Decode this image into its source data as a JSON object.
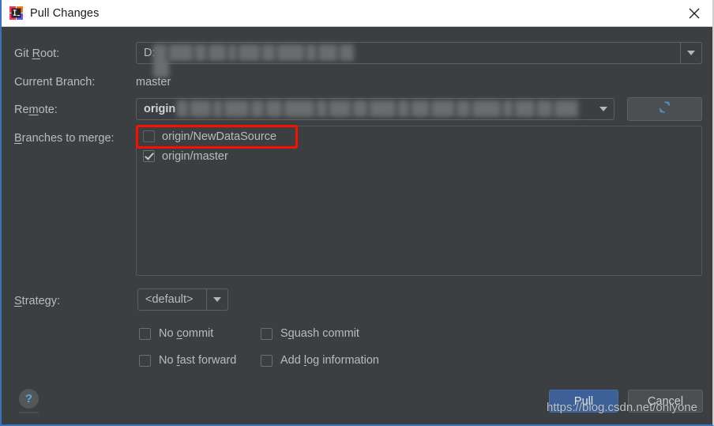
{
  "window": {
    "title": "Pull Changes",
    "app_icon": "intellij-idea-icon",
    "close_icon": "close-icon",
    "accent_color": "#3a74bf",
    "background_color": "#3c3f41",
    "text_color": "#bbbbbb"
  },
  "fields": {
    "git_root": {
      "label_before": "Git ",
      "label_mnemonic": "R",
      "label_after": "oot:",
      "value": "D:",
      "redacted": true,
      "dropdown_icon": "chevron-down-icon"
    },
    "current_branch": {
      "label": "Current Branch:",
      "value": "master"
    },
    "remote": {
      "label_before": "Re",
      "label_mnemonic": "m",
      "label_after": "ote:",
      "value": "origin",
      "redacted": true,
      "dropdown_icon": "chevron-down-icon",
      "refresh_icon": "refresh-icon",
      "refresh_color": "#4b8ec9"
    },
    "branches": {
      "label_before": "",
      "label_mnemonic": "B",
      "label_after": "ranches to merge:",
      "items": [
        {
          "name": "origin/NewDataSource",
          "checked": false,
          "highlighted": true
        },
        {
          "name": "origin/master",
          "checked": true,
          "highlighted": false
        }
      ],
      "highlight_color": "#fb0f00"
    },
    "strategy": {
      "label_before": "",
      "label_mnemonic": "S",
      "label_after": "trategy:",
      "value": "<default>",
      "dropdown_icon": "chevron-down-icon"
    }
  },
  "options": [
    {
      "before": "No ",
      "mnemonic": "c",
      "after": "ommit",
      "checked": false
    },
    {
      "before": "S",
      "mnemonic": "q",
      "after": "uash commit",
      "checked": false
    },
    {
      "before": "No ",
      "mnemonic": "f",
      "after": "ast forward",
      "checked": false
    },
    {
      "before": "Add ",
      "mnemonic": "l",
      "after": "og information",
      "checked": false
    }
  ],
  "footer": {
    "help_label": "?",
    "help_icon": "help-icon",
    "pull_label": "Pull",
    "cancel_label": "Cancel",
    "primary_color": "#3c6097"
  },
  "watermark": {
    "text": "https://blog.csdn.net/onlyone"
  }
}
